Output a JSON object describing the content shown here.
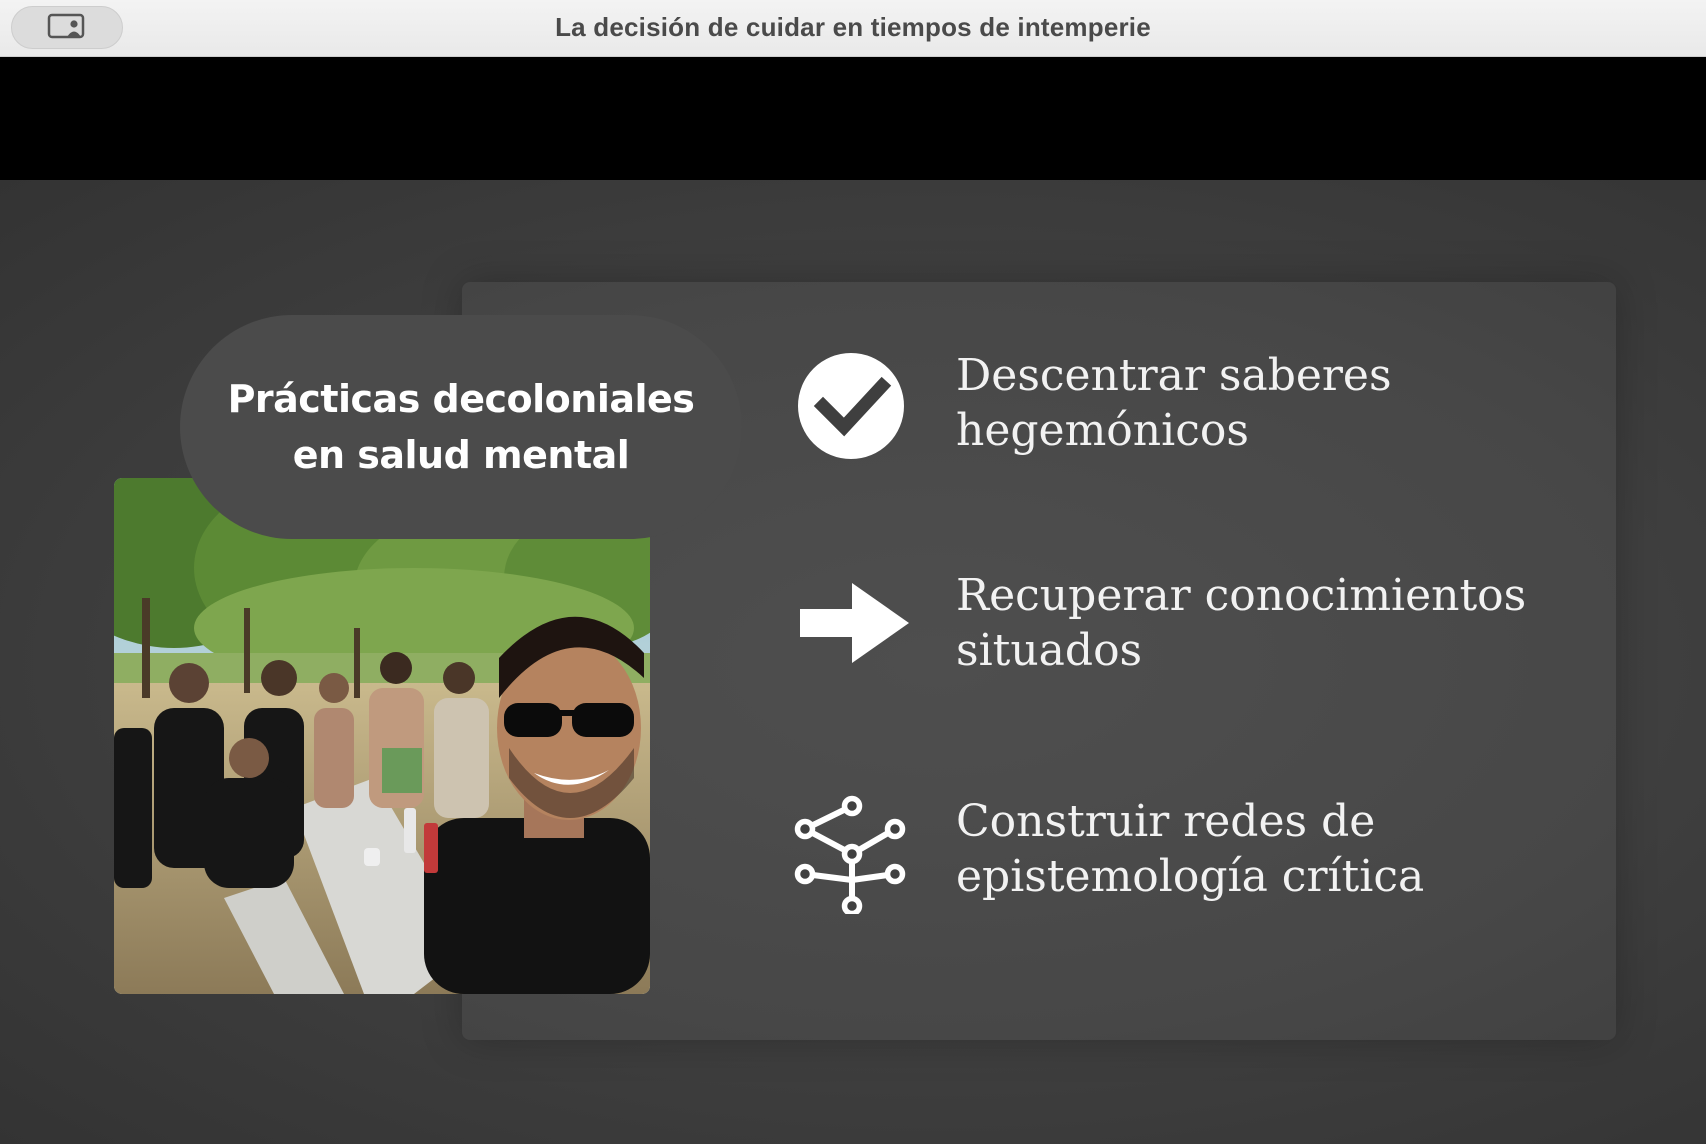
{
  "window": {
    "title": "La decisión de cuidar en tiempos de intemperie",
    "sidebar_button_icon": "sidebar-participant-icon"
  },
  "slide": {
    "heading": {
      "line1": "Prácticas decoloniales",
      "line2": "en salud mental"
    },
    "photo_icon": "group-photo",
    "items": [
      {
        "icon": "checkmark-circle-icon",
        "line1": "Descentrar saberes",
        "line2": "hegemónicos"
      },
      {
        "icon": "arrow-right-icon",
        "line1": "Recuperar conocimientos",
        "line2": "situados"
      },
      {
        "icon": "network-tree-icon",
        "line1": "Construir redes de",
        "line2": "epistemología crítica"
      }
    ]
  },
  "colors": {
    "titlebar": "#eeeeee",
    "band": "#000000",
    "slide_bg": "#404040",
    "text": "#f2f2f2"
  }
}
